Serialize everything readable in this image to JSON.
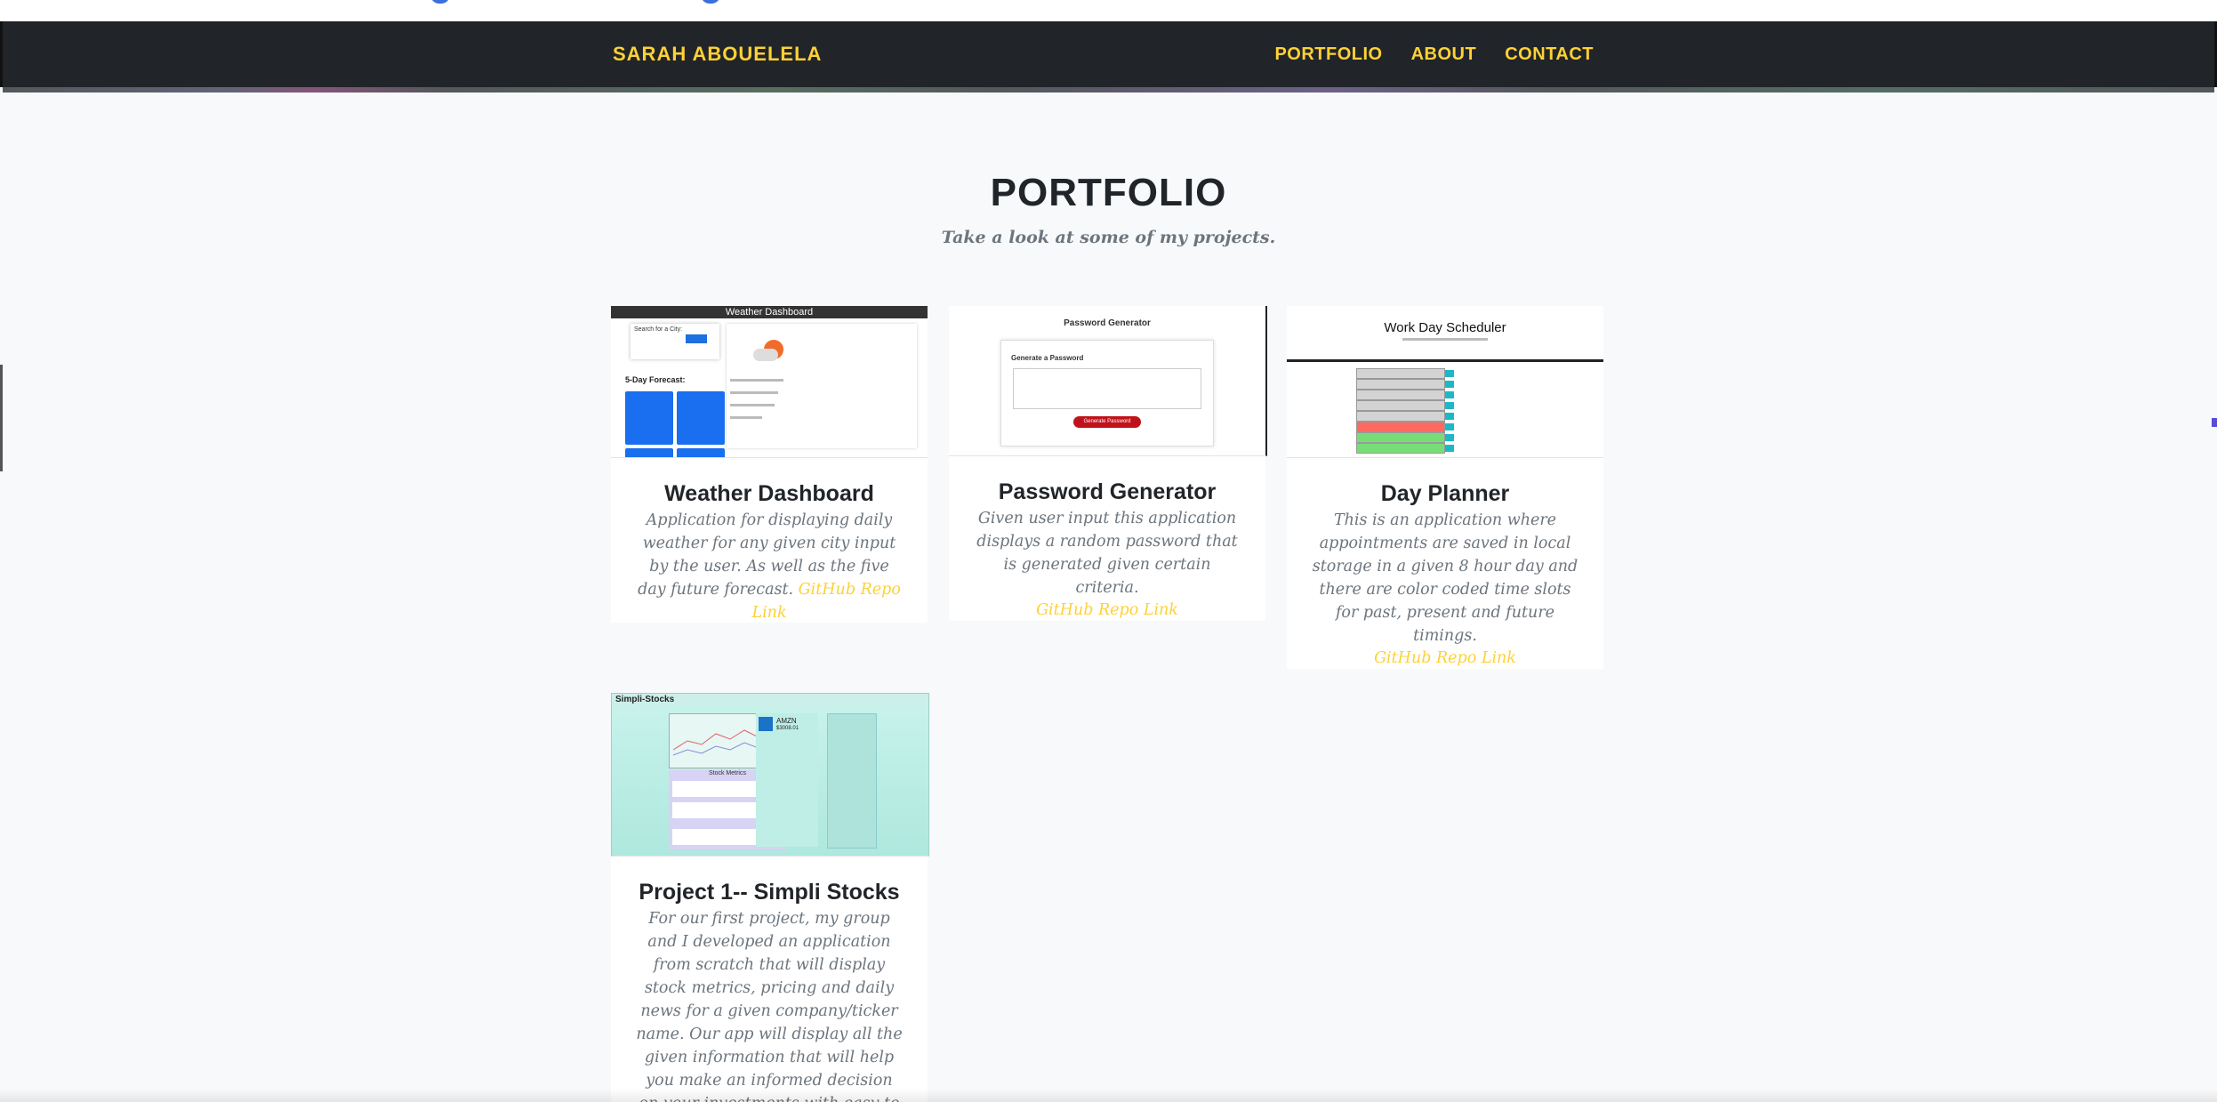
{
  "navbar": {
    "brand": "SARAH ABOUELELA",
    "links": [
      {
        "label": "PORTFOLIO"
      },
      {
        "label": "ABOUT"
      },
      {
        "label": "CONTACT"
      }
    ]
  },
  "portfolio": {
    "heading": "PORTFOLIO",
    "subheading": "Take a look at some of my projects.",
    "projects": [
      {
        "title": "Weather Dashboard",
        "description": "Application for displaying daily weather for any given city input by the user. As well as the five day future forecast.",
        "link_label": "GitHub Repo Link",
        "thumb_text": {
          "bar": "Weather Dashboard",
          "forecast": "5-Day Forecast:",
          "search": "Search for a City:"
        }
      },
      {
        "title": "Password Generator",
        "description": "Given user input this application displays a random password that is generated given certain criteria.",
        "link_label": "GitHub Repo Link",
        "thumb_text": {
          "title": "Password Generator",
          "label": "Generate a Password",
          "button": "Generate Password"
        }
      },
      {
        "title": "Day Planner",
        "description": "This is an application where appointments are saved in local storage in a given 8 hour day and there are color coded time slots for past, present and future timings.",
        "link_label": "GitHub Repo Link",
        "thumb_text": {
          "title": "Work Day Scheduler"
        }
      },
      {
        "title": "Project 1-- Simpli Stocks",
        "description": "For our first project, my group and I developed an application from scratch that will display stock metrics, pricing and daily news for a given company/ticker name. Our app will display all the given information that will help you make an informed decision on your investments with easy to use definitions in laymans",
        "thumb_text": {
          "nav": "Simpli-Stocks",
          "ticker": "AMZN",
          "price": "$3008.01",
          "metrics": "Stock Metrics"
        }
      }
    ]
  },
  "colors": {
    "accent": "#fed136",
    "navbar_bg": "#212529",
    "page_bg": "#f8f9fa",
    "heading": "#212529",
    "muted": "#6c757d"
  }
}
